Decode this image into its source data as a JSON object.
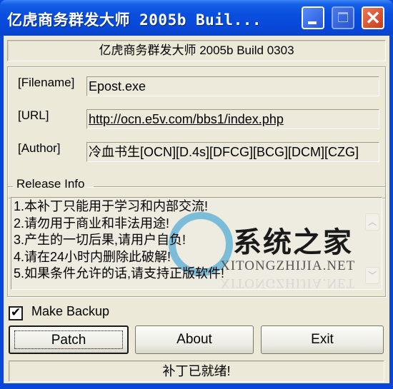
{
  "window": {
    "title": "亿虎商务群发大师 2005b Buil...",
    "controls": {
      "minimize": "minimize",
      "maximize": "maximize",
      "close": "✕"
    }
  },
  "header": {
    "text": "亿虎商务群发大师 2005b Build 0303"
  },
  "info": {
    "filename_label": "[Filename]",
    "filename_value": "Epost.exe",
    "url_label": "[URL]",
    "url_value": "http://ocn.e5v.com/bbs1/index.php",
    "author_label": "[Author]",
    "author_value": "冷血书生[OCN][D.4s][DFCG][BCG][DCM][CZG]"
  },
  "release": {
    "legend": "Release Info",
    "lines": [
      "1.本补丁只能用于学习和内部交流!",
      "2.请勿用于商业和非法用途!",
      "3.产生的一切后果,请用户自负!",
      "4.请在24小时内删除此破解!",
      "5.如果条件允许的话,请支持正版软件!"
    ],
    "scroll_up": "︿",
    "scroll_down": "﹀"
  },
  "watermark": {
    "cn": "系统之家",
    "en": "XITONGZHIJIA.NET"
  },
  "backup": {
    "label": "Make Backup",
    "checked": true
  },
  "buttons": {
    "patch": "Patch",
    "about": "About",
    "exit": "Exit"
  },
  "status": {
    "text": "补丁已就绪!"
  }
}
